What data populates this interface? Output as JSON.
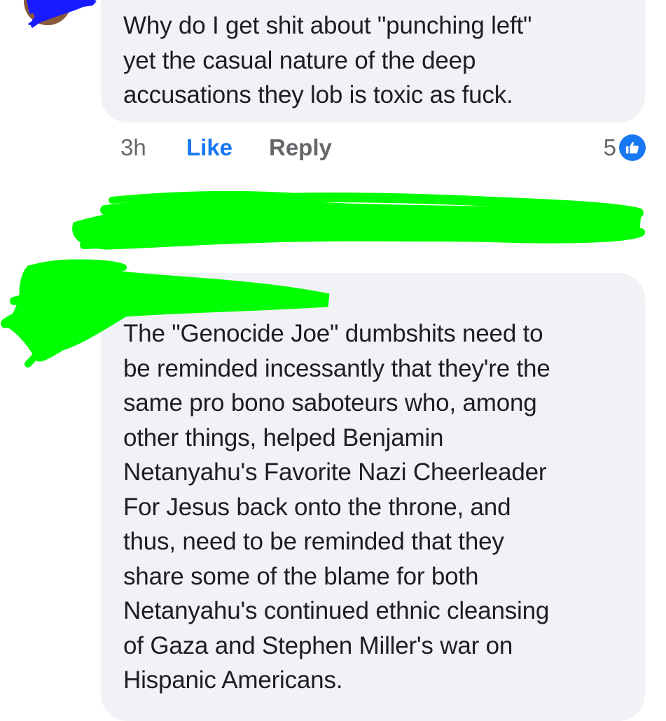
{
  "comment_1": {
    "text": "Why do I get shit about \"punching left\"\nyet the casual nature of the deep\naccusations they lob is toxic as fuck.",
    "time": "3h",
    "like_label": "Like",
    "reply_label": "Reply",
    "reaction_count": "5",
    "reaction_icon": "like-icon"
  },
  "comment_2": {
    "text": "The \"Genocide Joe\" dumbshits need to\nbe reminded incessantly that they're the\nsame pro bono saboteurs who, among\nother things, helped Benjamin\nNetanyahu's Favorite Nazi Cheerleader\nFor Jesus back onto the throne, and\nthus, need to be reminded that they\nshare some of the blame for both\nNetanyahu's continued ethnic cleansing\nof Gaza and Stephen Miller's war on\nHispanic Americans."
  },
  "colors": {
    "bubble_bg": "#f0f2f5",
    "like_blue": "#1877f2",
    "meta_gray": "#65676b",
    "redaction_green": "#00ff00",
    "redaction_blue": "#1a1aff"
  }
}
